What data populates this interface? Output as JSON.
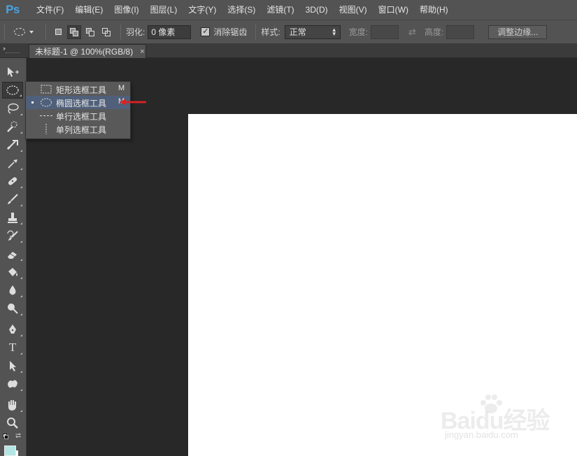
{
  "app": {
    "logo": "Ps",
    "menu": [
      "文件(F)",
      "编辑(E)",
      "图像(I)",
      "图层(L)",
      "文字(Y)",
      "选择(S)",
      "滤镜(T)",
      "3D(D)",
      "视图(V)",
      "窗口(W)",
      "帮助(H)"
    ]
  },
  "options": {
    "feather_label": "羽化:",
    "feather_value": "0 像素",
    "antialias_label": "消除锯齿",
    "antialias_checked": true,
    "style_label": "样式:",
    "style_value": "正常",
    "width_label": "宽度:",
    "height_label": "高度:",
    "refine_edge_label": "调整边缘..."
  },
  "document": {
    "tab_title": "未标题-1 @ 100%(RGB/8)",
    "close_glyph": "×"
  },
  "toolbar": {
    "tools": [
      "move-tool",
      "elliptical-marquee-tool",
      "lasso-tool",
      "quick-selection-tool",
      "crop-tool",
      "eyedropper-tool",
      "spot-healing-tool",
      "brush-tool",
      "clone-stamp-tool",
      "history-brush-tool",
      "eraser-tool",
      "paint-bucket-tool",
      "blur-tool",
      "dodge-tool",
      "pen-tool",
      "type-tool",
      "path-selection-tool",
      "custom-shape-tool",
      "hand-tool",
      "zoom-tool"
    ],
    "active_tool": "elliptical-marquee-tool",
    "foreground_color": "#b3e6e3",
    "background_color": "#ffffff"
  },
  "flyout": {
    "items": [
      {
        "label": "矩形选框工具",
        "shortcut": "M",
        "icon": "rectangular-marquee-icon",
        "selected": false
      },
      {
        "label": "椭圆选框工具",
        "shortcut": "M",
        "icon": "elliptical-marquee-icon",
        "selected": true
      },
      {
        "label": "单行选框工具",
        "shortcut": "",
        "icon": "single-row-marquee-icon",
        "selected": false
      },
      {
        "label": "单列选框工具",
        "shortcut": "",
        "icon": "single-column-marquee-icon",
        "selected": false
      }
    ]
  },
  "watermark": {
    "brand": "Baidu经验",
    "url": "jingyan.baidu.com"
  },
  "colors": {
    "ui_dark": "#535353",
    "workspace": "#282828",
    "canvas": "#ffffff",
    "ps_blue": "#4aa3e0",
    "annotation_red": "#e02020"
  }
}
